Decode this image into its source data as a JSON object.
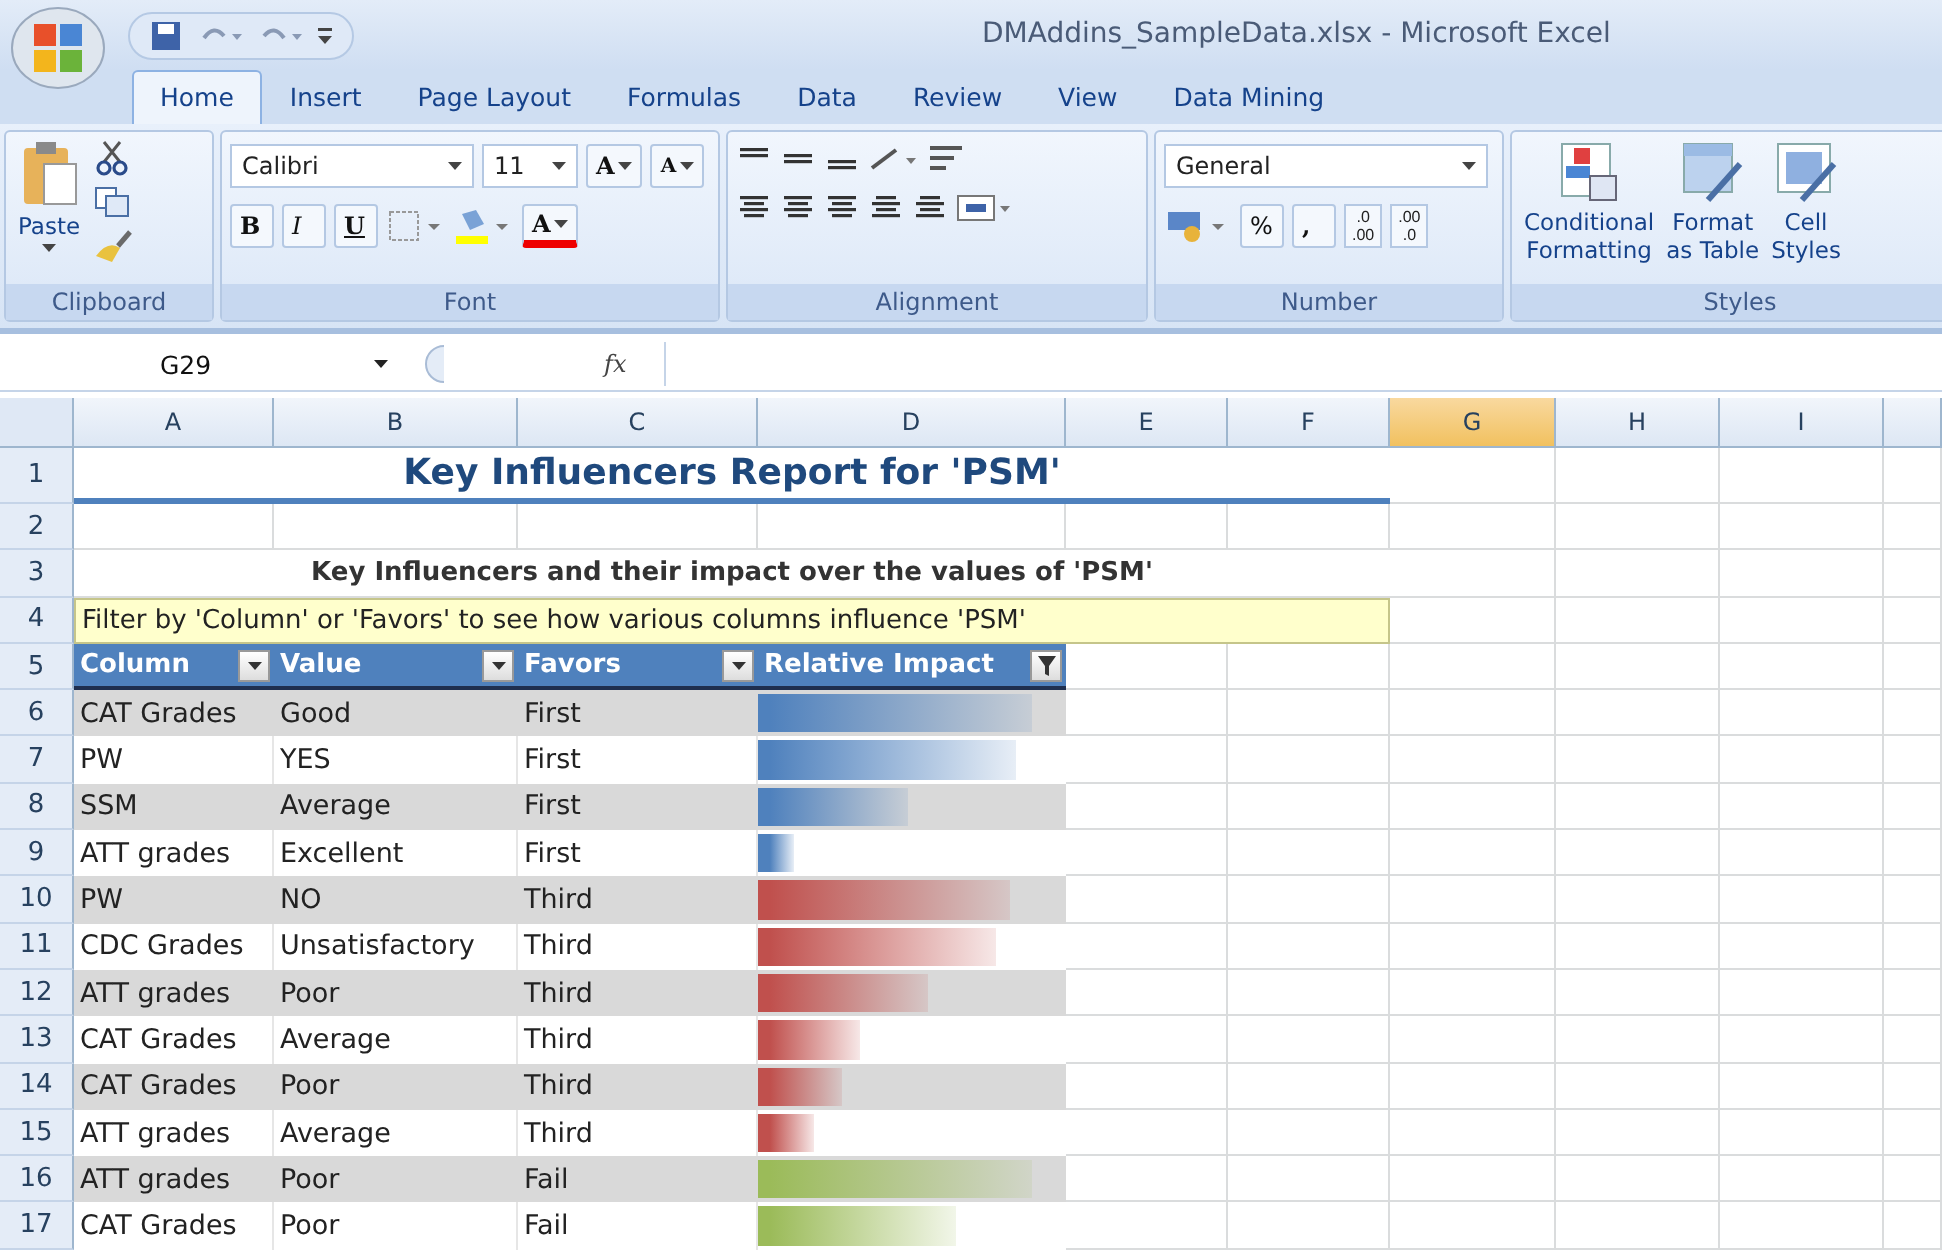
{
  "window": {
    "title": "DMAddins_SampleData.xlsx - Microsoft Excel"
  },
  "tabs": [
    {
      "label": "Home",
      "selected": true
    },
    {
      "label": "Insert",
      "selected": false
    },
    {
      "label": "Page Layout",
      "selected": false
    },
    {
      "label": "Formulas",
      "selected": false
    },
    {
      "label": "Data",
      "selected": false
    },
    {
      "label": "Review",
      "selected": false
    },
    {
      "label": "View",
      "selected": false
    },
    {
      "label": "Data Mining",
      "selected": false
    }
  ],
  "ribbon": {
    "clipboard": {
      "title": "Clipboard",
      "paste": "Paste"
    },
    "font": {
      "title": "Font",
      "name": "Calibri",
      "size": "11",
      "grow": "A",
      "shrink": "A",
      "bold": "B",
      "italic": "I",
      "underline": "U",
      "font_color_letter": "A"
    },
    "alignment": {
      "title": "Alignment"
    },
    "number": {
      "title": "Number",
      "format": "General",
      "percent": "%",
      "comma": ",",
      "increase": [
        ".0",
        ".00"
      ],
      "decrease": [
        ".00",
        ".0"
      ]
    },
    "styles": {
      "title": "Styles",
      "buttons": [
        {
          "lines": [
            "Conditional",
            "Formatting"
          ],
          "kind": "conditional"
        },
        {
          "lines": [
            "Format",
            "as Table"
          ],
          "kind": "table"
        },
        {
          "lines": [
            "Cell",
            "Styles"
          ],
          "kind": "cell"
        }
      ]
    }
  },
  "formula_bar": {
    "name_box": "G29",
    "fx": "fx"
  },
  "columns": [
    {
      "label": "A",
      "selected": false
    },
    {
      "label": "B",
      "selected": false
    },
    {
      "label": "C",
      "selected": false
    },
    {
      "label": "D",
      "selected": false
    },
    {
      "label": "E",
      "selected": false
    },
    {
      "label": "F",
      "selected": false
    },
    {
      "label": "G",
      "selected": true
    },
    {
      "label": "H",
      "selected": false
    },
    {
      "label": "I",
      "selected": false
    }
  ],
  "report": {
    "title": "Key Influencers Report for 'PSM'",
    "subtitle": "Key Influencers and their impact over the values of 'PSM'",
    "note": "Filter by 'Column' or 'Favors' to see how various columns influence 'PSM'"
  },
  "table": {
    "headers": [
      "Column",
      "Value",
      "Favors",
      "Relative Impact"
    ],
    "rows": [
      {
        "row": "6",
        "column": "CAT Grades",
        "value": "Good",
        "favors": "First",
        "level": 0.89,
        "color": "#4f81bd"
      },
      {
        "row": "7",
        "column": "PW",
        "value": "YES",
        "favors": "First",
        "level": 0.84,
        "color": "#4f81bd"
      },
      {
        "row": "8",
        "column": "SSM",
        "value": "Average",
        "favors": "First",
        "level": 0.49,
        "color": "#4f81bd"
      },
      {
        "row": "9",
        "column": "ATT grades",
        "value": "Excellent",
        "favors": "First",
        "level": 0.12,
        "color": "#4f81bd"
      },
      {
        "row": "10",
        "column": "PW",
        "value": "NO",
        "favors": "Third",
        "level": 0.82,
        "color": "#c0504d"
      },
      {
        "row": "11",
        "column": "CDC Grades",
        "value": "Unsatisfactory",
        "favors": "Third",
        "level": 0.77,
        "color": "#c0504d"
      },
      {
        "row": "12",
        "column": "ATT grades",
        "value": "Poor",
        "favors": "Third",
        "level": 0.55,
        "color": "#c0504d"
      },
      {
        "row": "13",
        "column": "CAT Grades",
        "value": "Average",
        "favors": "Third",
        "level": 0.33,
        "color": "#c0504d"
      },
      {
        "row": "14",
        "column": "CAT Grades",
        "value": "Poor",
        "favors": "Third",
        "level": 0.27,
        "color": "#c0504d"
      },
      {
        "row": "15",
        "column": "ATT grades",
        "value": "Average",
        "favors": "Third",
        "level": 0.18,
        "color": "#c0504d"
      },
      {
        "row": "16",
        "column": "ATT grades",
        "value": "Poor",
        "favors": "Fail",
        "level": 0.89,
        "color": "#9bbb59"
      },
      {
        "row": "17",
        "column": "CAT Grades",
        "value": "Poor",
        "favors": "Fail",
        "level": 0.64,
        "color": "#9bbb59"
      }
    ]
  },
  "row_numbers": [
    "1",
    "2",
    "3",
    "4",
    "5"
  ]
}
